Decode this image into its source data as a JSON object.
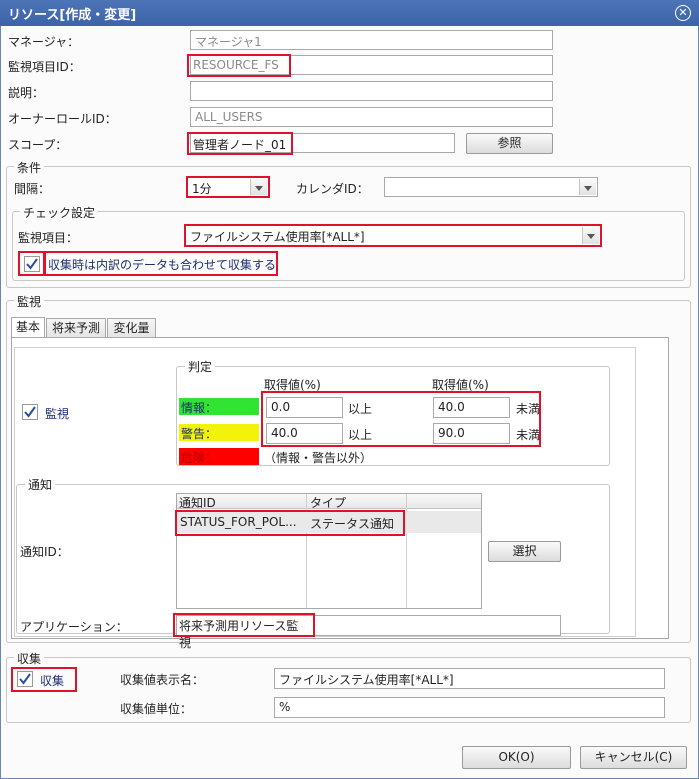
{
  "window": {
    "title": "リソース[作成・変更]"
  },
  "form": {
    "manager_label": "マネージャ：",
    "manager_value": "マネージャ1",
    "monitor_id_label": "監視項目ID：",
    "monitor_id_value": "RESOURCE_FS",
    "description_label": "説明：",
    "description_value": "",
    "owner_role_label": "オーナーロールID：",
    "owner_role_value": "ALL_USERS",
    "scope_label": "スコープ：",
    "scope_value": "管理者ノード_01",
    "scope_button": "参照"
  },
  "conditions": {
    "group_label": "条件",
    "interval_label": "間隔：",
    "interval_value": "1分",
    "calendar_label": "カレンダID：",
    "calendar_value": "",
    "check_group_label": "チェック設定",
    "monitor_item_label": "監視項目：",
    "monitor_item_value": "ファイルシステム使用率[*ALL*]",
    "collect_breakdown_label": "収集時は内訳のデータも合わせて収集する",
    "collect_breakdown_checked": true
  },
  "monitor": {
    "group_label": "監視",
    "tabs": [
      {
        "label": "基本",
        "active": true
      },
      {
        "label": "将来予測",
        "active": false
      },
      {
        "label": "変化量",
        "active": false
      }
    ],
    "monitor_label": "監視",
    "monitor_checked": true,
    "judgement": {
      "group_label": "判定",
      "col_header_1": "取得値(%)",
      "col_header_2": "取得値(%)",
      "info_label": "情報：",
      "warning_label": "警告：",
      "critical_label": "危険：",
      "info_color": "#33e333",
      "warning_color": "#f2f20a",
      "critical_color": "#ff0000",
      "info_lower": "0.0",
      "info_upper": "40.0",
      "warning_lower": "40.0",
      "warning_upper": "90.0",
      "above_label": "以上",
      "below_label": "未満",
      "critical_note": "（情報・警告以外）"
    },
    "notify": {
      "group_label": "通知",
      "notify_id_label": "通知ID：",
      "columns": [
        "通知ID",
        "タイプ"
      ],
      "rows": [
        {
          "id": "STATUS_FOR_POL...",
          "type": "ステータス通知"
        }
      ],
      "select_button": "選択",
      "application_label": "アプリケーション：",
      "application_value": "将来予測用リソース監視"
    }
  },
  "collect": {
    "group_label": "収集",
    "collect_label": "収集",
    "collect_checked": true,
    "display_name_label": "収集値表示名：",
    "display_name_value": "ファイルシステム使用率[*ALL*]",
    "unit_label": "収集値単位：",
    "unit_value": "%"
  },
  "footer": {
    "ok_button": "OK(O)",
    "cancel_button": "キャンセル(C)"
  }
}
